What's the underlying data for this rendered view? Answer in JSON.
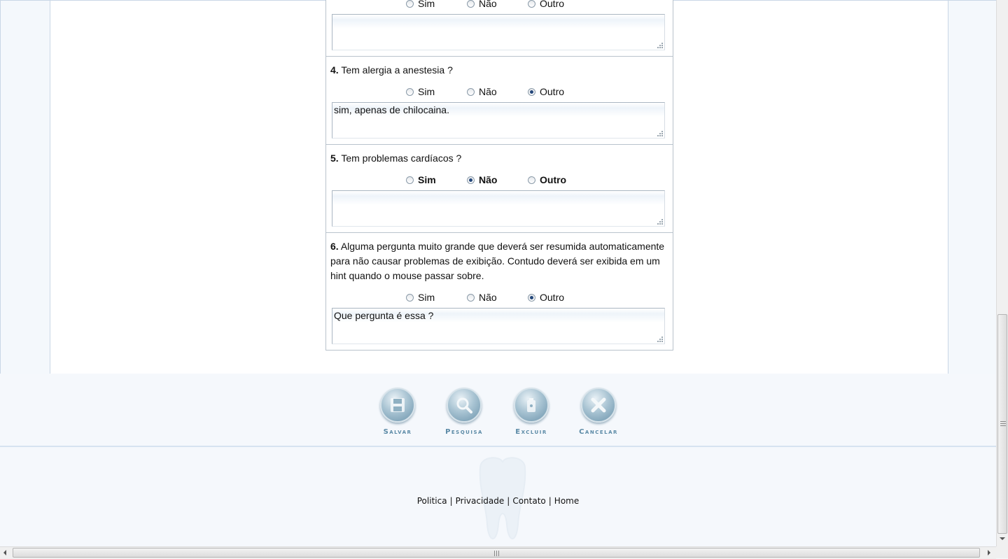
{
  "questions": [
    {
      "num": "",
      "text": "",
      "options": [
        "Sim",
        "Não",
        "Outro"
      ],
      "selected": null,
      "answer": ""
    },
    {
      "num": "4.",
      "text": "Tem alergia a anestesia ?",
      "options": [
        "Sim",
        "Não",
        "Outro"
      ],
      "selected": "Outro",
      "answer": "sim, apenas de chilocaina."
    },
    {
      "num": "5.",
      "text": "Tem problemas cardíacos ?",
      "options": [
        "Sim",
        "Não",
        "Outro"
      ],
      "selected": "Não",
      "answer": ""
    },
    {
      "num": "6.",
      "text": "Alguma pergunta muito grande que deverá ser resumida automaticamente para não causar problemas de exibição. Contudo deverá ser exibida em um hint quando o mouse passar sobre.",
      "options": [
        "Sim",
        "Não",
        "Outro"
      ],
      "selected": "Outro",
      "answer": "Que pergunta é essa ?"
    }
  ],
  "actions": {
    "save": "Salvar",
    "search": "Pesquisa",
    "delete": "Excluir",
    "cancel": "Cancelar"
  },
  "footer": {
    "links": [
      "Politica",
      "Privacidade",
      "Contato",
      "Home"
    ],
    "separator": "|"
  },
  "icons": {
    "save": "floppy-disk-icon",
    "search": "magnifier-icon",
    "delete": "trash-icon",
    "cancel": "x-icon"
  },
  "colors": {
    "accent": "#5b8aa6",
    "selected_radio": "#24477a"
  }
}
